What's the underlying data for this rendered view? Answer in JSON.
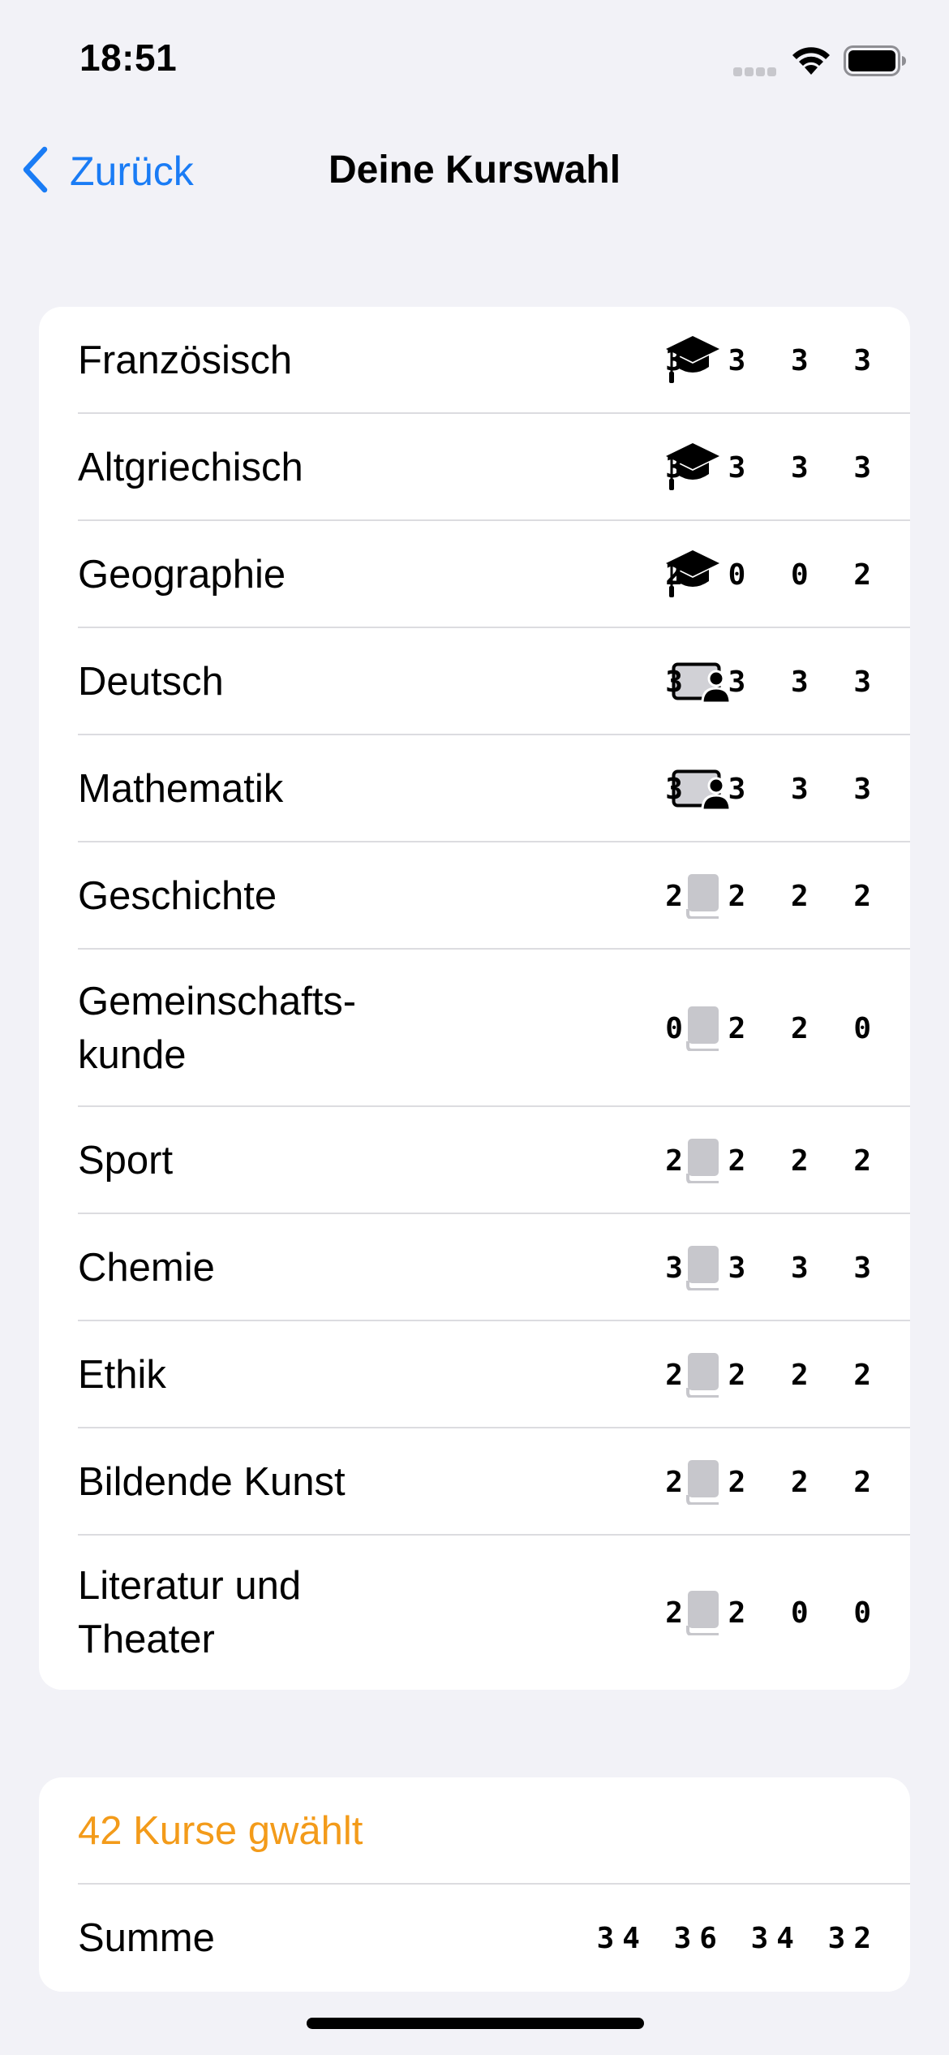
{
  "status_bar": {
    "time": "18:51"
  },
  "nav": {
    "back_label": "Zurück",
    "title": "Deine Kurswahl"
  },
  "courses": [
    {
      "name": "Französisch",
      "icon": "graduation-cap-icon",
      "values": "3 3 3 3"
    },
    {
      "name": "Altgriechisch",
      "icon": "graduation-cap-icon",
      "values": "3 3 3 3"
    },
    {
      "name": "Geographie",
      "icon": "graduation-cap-icon",
      "values": "2 0 0 2"
    },
    {
      "name": "Deutsch",
      "icon": "teacher-board-icon",
      "values": "3 3 3 3"
    },
    {
      "name": "Mathematik",
      "icon": "teacher-board-icon",
      "values": "3 3 3 3"
    },
    {
      "name": "Geschichte",
      "icon": "book-icon",
      "values": "2 2 2 2"
    },
    {
      "name": "Gemeinschafts-\nkunde",
      "icon": "book-icon",
      "values": "0 2 2 0"
    },
    {
      "name": "Sport",
      "icon": "book-icon",
      "values": "2 2 2 2"
    },
    {
      "name": "Chemie",
      "icon": "book-icon",
      "values": "3 3 3 3"
    },
    {
      "name": "Ethik",
      "icon": "book-icon",
      "values": "2 2 2 2"
    },
    {
      "name": "Bildende Kunst",
      "icon": "book-icon",
      "values": "2 2 2 2"
    },
    {
      "name": "Literatur und\nTheater",
      "icon": "book-icon",
      "values": "2 2 0 0"
    }
  ],
  "summary": {
    "status": "42 Kurse gwählt",
    "sum_label": "Summe",
    "sum_values": "34 36 34 32"
  },
  "colors": {
    "accent": "#1a7cf5",
    "warning": "#f39b1a",
    "background": "#f2f2f7"
  }
}
